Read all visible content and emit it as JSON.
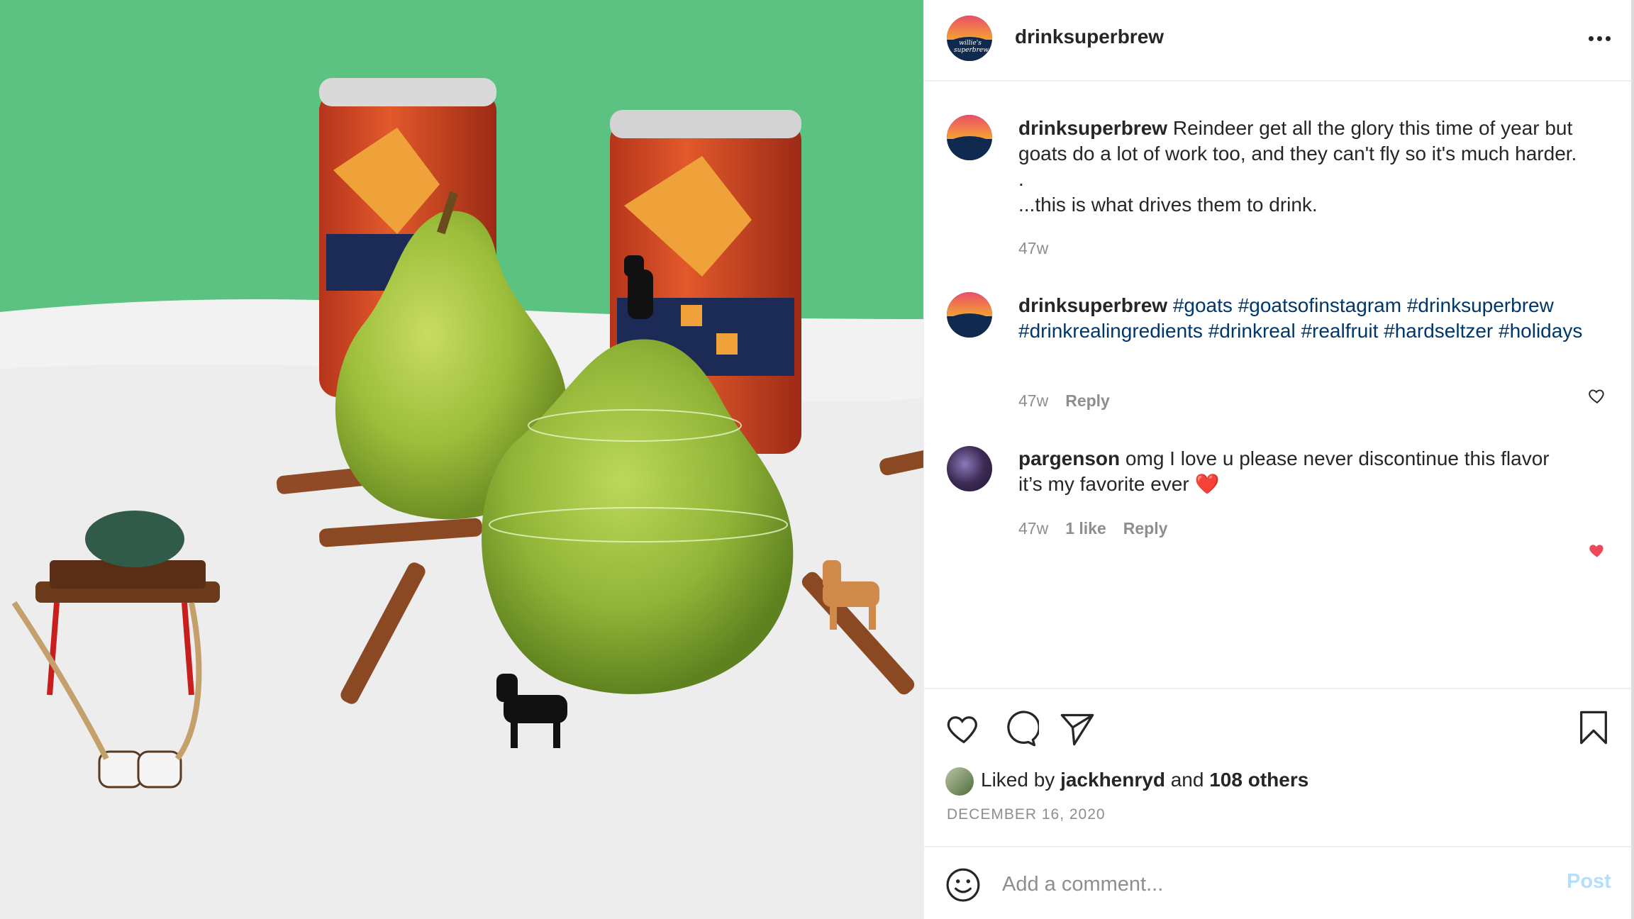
{
  "post": {
    "author": "drinksuperbrew",
    "avatar_text": "willie's superbrew",
    "more_icon": "more-horizontal-icon",
    "caption": {
      "username": "drinksuperbrew",
      "line1": "Reindeer get all the glory this time of year but goats do a lot of work too, and they can't fly so it's much harder.",
      "line2": ".",
      "line3": "...this is what drives them to drink.",
      "time": "47w"
    },
    "comments": [
      {
        "username": "drinksuperbrew",
        "hashtags": "#goats #goatsofinstagram #drinksuperbrew #drinkrealingredients #drinkreal #realfruit #hardseltzer #holidays",
        "time": "47w",
        "reply_label": "Reply",
        "liked": false
      },
      {
        "username": "pargenson",
        "text": "omg I love u please never discontinue this flavor it’s my favorite ever ❤️",
        "time": "47w",
        "likes_label": "1 like",
        "reply_label": "Reply",
        "liked": true
      }
    ],
    "likes": {
      "prefix": "Liked by",
      "user": "jackhenryd",
      "conjunction": "and",
      "others": "108 others"
    },
    "date": "DECEMBER 16, 2020",
    "add_comment": {
      "placeholder": "Add a comment...",
      "post_label": "Post"
    }
  },
  "colors": {
    "link": "#00376b",
    "muted": "#8e8e8e",
    "heart_red": "#ed4956",
    "post_disabled": "#b2dffc",
    "photo_backdrop": "#5cc282"
  }
}
